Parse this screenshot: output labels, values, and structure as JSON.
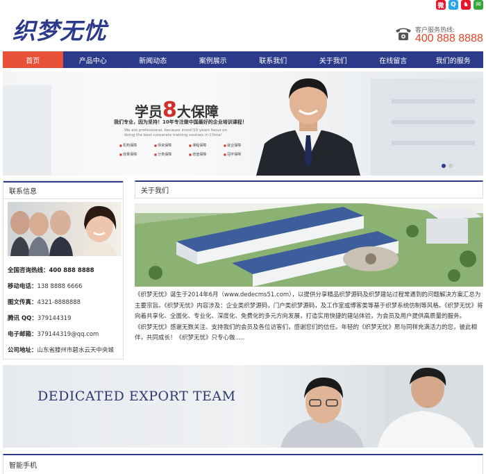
{
  "header": {
    "logo_text": "织梦无忧",
    "hotline_label": "客户服务热线:",
    "hotline_number": "400 888 8888",
    "social_icons": [
      "weibo-icon",
      "qzone-icon",
      "qq-icon",
      "wechat-icon"
    ],
    "colors": {
      "brand": "#2c3a8a",
      "accent": "#e65137"
    }
  },
  "nav": {
    "items": [
      "首页",
      "产品中心",
      "新闻动态",
      "案例展示",
      "联系我们",
      "关于我们",
      "在线留言",
      "我们的服务"
    ],
    "active_index": 0
  },
  "banner": {
    "title_prefix": "学员",
    "title_number": "8",
    "title_suffix": "大保障",
    "subtitle": "我们专业，因为坚持！10年专注做中国最好的企业培训课程！",
    "english": "We are professional, because insist!10 years focus on doing the best corporate training courses in China!",
    "tags": [
      "机构保障",
      "师资保障",
      "课程保障",
      "就业保障",
      "效果保障",
      "分类保障",
      "增值保障",
      "冠字保障"
    ],
    "slides": 2,
    "active_slide": 0
  },
  "contact": {
    "heading": "联系信息",
    "rows": [
      {
        "label": "全国咨询热线：",
        "value": "400 888 8888",
        "bold_value": true
      },
      {
        "label": "移动电话：",
        "value": "138 8888 6666",
        "bold_value": false
      },
      {
        "label": "图文传真：",
        "value": "4321-8888888",
        "bold_value": false
      },
      {
        "label": "腾讯 QQ：",
        "value": "379144319",
        "bold_value": false
      },
      {
        "label": "电子邮箱：",
        "value": "379144319@qq.com",
        "bold_value": false
      },
      {
        "label": "公司地址：",
        "value": "山东省滕州市碧水云天中央城",
        "bold_value": false
      }
    ]
  },
  "about": {
    "heading": "关于我们",
    "paragraph1": "《织梦无忧》诞生于2014年6月（www.dedecms51.com），以提供分享精品织梦源码及织梦建站过程常遇到的问题解决方案汇总为主要宗旨。《织梦无忧》内容涉及：企业类织梦源码，门户类织梦源码，及工作室或博客类等基于织梦系统仿制等风格。《织梦无忧》将向着共享化、全面化、专业化、深度化、免费化的多元方向发展，打造实用快捷的建站体验，为会员及用户提供高质量的服务。",
    "paragraph2": "《织梦无忧》感谢无数关注、支持我们的会员及各位访客们，感谢您们的信任。年轻的《织梦无忧》愿与同样充满活力的您，彼此相伴，共同成长！《织梦无忧》只专心做….."
  },
  "team_banner": {
    "text": "DEDICATED EXPORT TEAM"
  },
  "bottom": {
    "heading": "智能手机"
  }
}
